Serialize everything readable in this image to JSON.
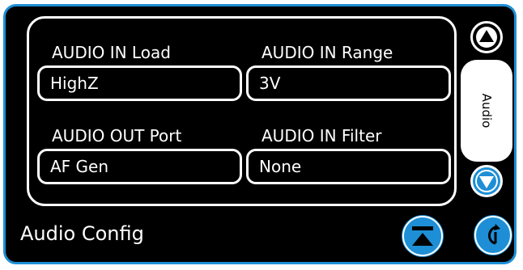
{
  "screen": {
    "title": "Audio Config"
  },
  "fields": {
    "audio_in_load": {
      "label": "AUDIO IN Load",
      "value": "HighZ"
    },
    "audio_in_range": {
      "label": "AUDIO IN Range",
      "value": "3V"
    },
    "audio_out_port": {
      "label": "AUDIO OUT Port",
      "value": "AF Gen"
    },
    "audio_in_filter": {
      "label": "AUDIO IN Filter",
      "value": "None"
    }
  },
  "side_tabs": {
    "active_tab": "Audio",
    "scroll_up_icon": "triangle-up-icon",
    "scroll_down_icon": "triangle-down-icon"
  },
  "footer_buttons": {
    "top_icon": "scroll-to-top-icon",
    "back_icon": "back-arrow-icon"
  },
  "colors": {
    "background": "#000000",
    "frame_border": "#1e8fd6",
    "accent_blue": "#1e8fd6",
    "text": "#ffffff"
  }
}
